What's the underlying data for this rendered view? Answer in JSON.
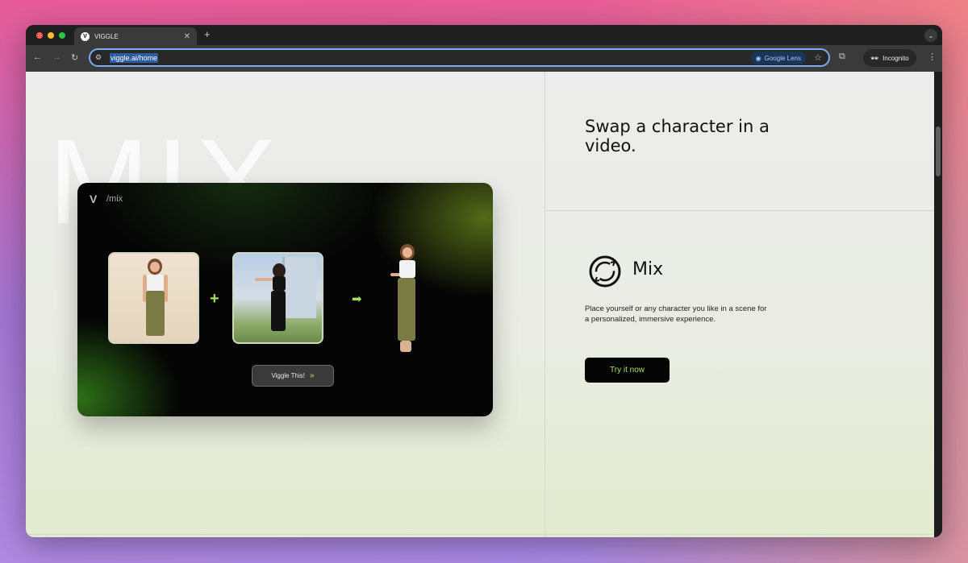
{
  "browser": {
    "tab_title": "VIGGLE",
    "tab_favicon": "V",
    "url": "viggle.ai/home",
    "lens_label": "Google Lens",
    "incognito_label": "Incognito"
  },
  "page": {
    "watermark": "MIX",
    "card": {
      "label": "/mix",
      "button_label": "Viggle This!"
    },
    "headline": "Swap a character in a video.",
    "feature": {
      "title": "Mix",
      "description": "Place yourself or any character you like in a scene for a personalized, immersive experience.",
      "cta_label": "Try it now"
    }
  },
  "colors": {
    "accent": "#a6e35a",
    "omnibox_border": "#7cacf8"
  },
  "icons": [
    "close-icon",
    "plus-icon",
    "back-icon",
    "forward-icon",
    "reload-icon",
    "site-settings-icon",
    "lens-icon",
    "star-icon",
    "extensions-icon",
    "incognito-icon",
    "kebab-icon",
    "chevron-down-icon",
    "viggle-logo-icon",
    "mix-icon",
    "arrow-right-icon",
    "double-chevron-icon"
  ]
}
